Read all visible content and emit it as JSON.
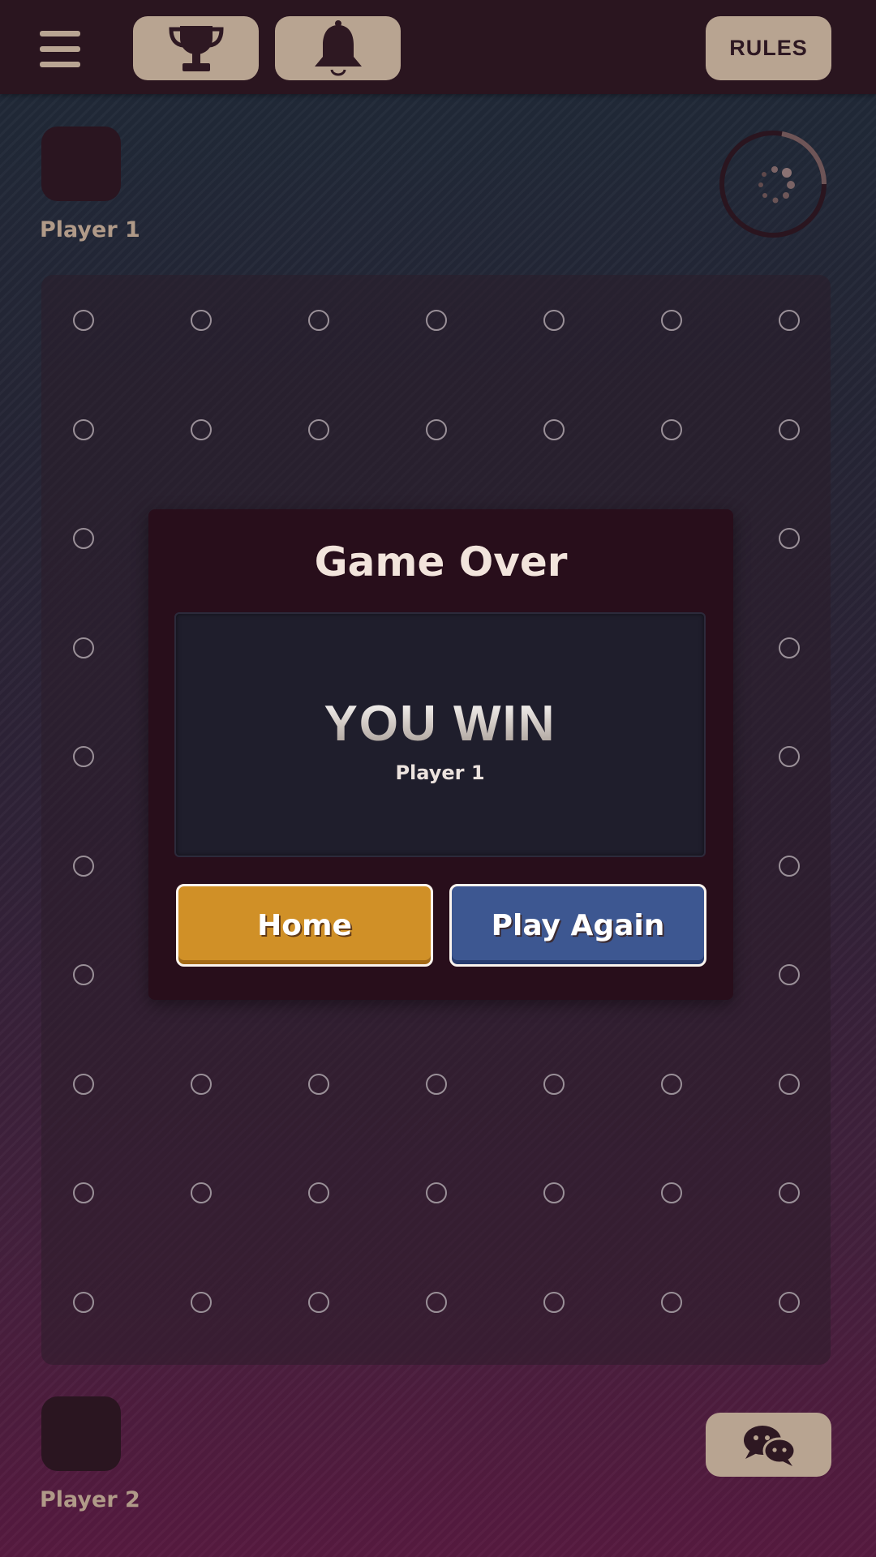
{
  "topbar": {
    "menu_icon": "hamburger-menu-icon",
    "trophy_icon": "trophy-icon",
    "bell_icon": "bell-icon",
    "rules_label": "RULES"
  },
  "players": {
    "top": {
      "name": "Player 1"
    },
    "bottom": {
      "name": "Player 2"
    }
  },
  "board": {
    "rows": 10,
    "cols": 7
  },
  "modal": {
    "title": "Game Over",
    "result": "YOU WIN",
    "winner": "Player 1",
    "home_label": "Home",
    "play_again_label": "Play Again"
  },
  "chat": {
    "icon": "chat-bubbles-icon"
  },
  "colors": {
    "topbar": "#2a151f",
    "pill": "#b8a491",
    "modal": "#280e1b",
    "home_button": "#d09027",
    "play_again_button": "#3d5791"
  }
}
